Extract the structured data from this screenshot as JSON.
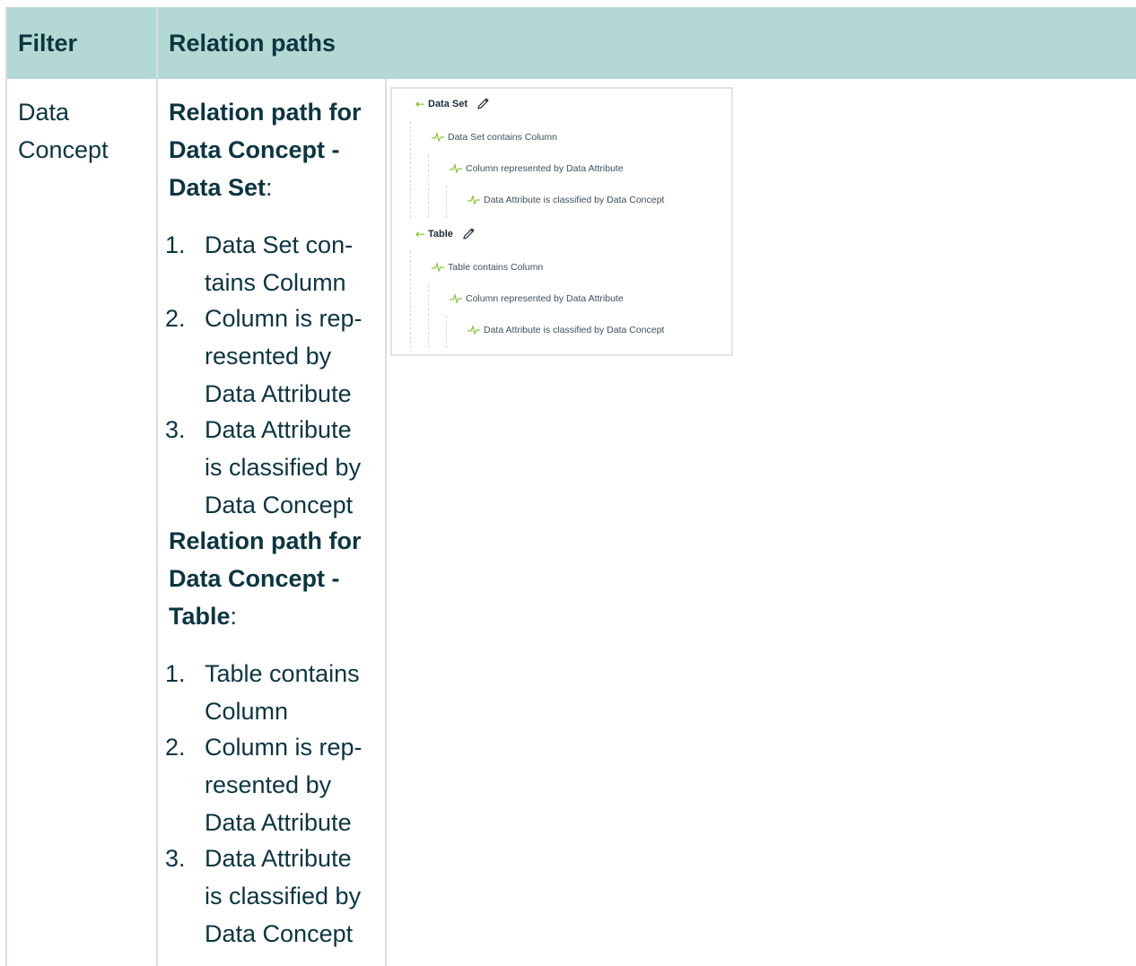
{
  "header": {
    "filter_label": "Filter",
    "paths_label": "Relation paths"
  },
  "row": {
    "filter_value_line1": "Data",
    "filter_value_line2": "Concept",
    "groups": [
      {
        "heading_prefix": "Relation path for",
        "heading_line2": "Data Concept -",
        "heading_target": "Data Set",
        "colon": ":",
        "steps": [
          {
            "num": "1.",
            "lines": [
              "Data Set con-",
              "tains Column"
            ]
          },
          {
            "num": "2.",
            "lines": [
              "Column is rep-",
              "resented by",
              "Data Attribute"
            ]
          },
          {
            "num": "3.",
            "lines": [
              "Data Attribute",
              "is classified by",
              "Data Concept"
            ]
          }
        ]
      },
      {
        "heading_prefix": "Relation path for",
        "heading_line2": "Data Concept -",
        "heading_target": "Table",
        "colon": ":",
        "steps": [
          {
            "num": "1.",
            "lines": [
              "Table contains",
              "Column"
            ]
          },
          {
            "num": "2.",
            "lines": [
              "Column is rep-",
              "resented by",
              "Data Attribute"
            ]
          },
          {
            "num": "3.",
            "lines": [
              "Data Attribute",
              "is classified by",
              "Data Concept"
            ]
          }
        ]
      }
    ]
  },
  "screenshot": {
    "trees": [
      {
        "root": "Data Set",
        "relations": [
          "Data Set contains Column",
          "Column represented by Data Attribute",
          "Data Attribute is classified by Data Concept"
        ]
      },
      {
        "root": "Table",
        "relations": [
          "Table contains Column",
          "Column represented by Data Attribute",
          "Data Attribute is classified by Data Concept"
        ]
      }
    ],
    "icons": {
      "root_arrow": "arrow-left-icon",
      "edit": "pencil-icon",
      "relation": "pulse-icon"
    },
    "colors": {
      "accent_green": "#8cc63f",
      "header_bg": "#b4d8d3",
      "text_dark": "#0c3540"
    }
  }
}
